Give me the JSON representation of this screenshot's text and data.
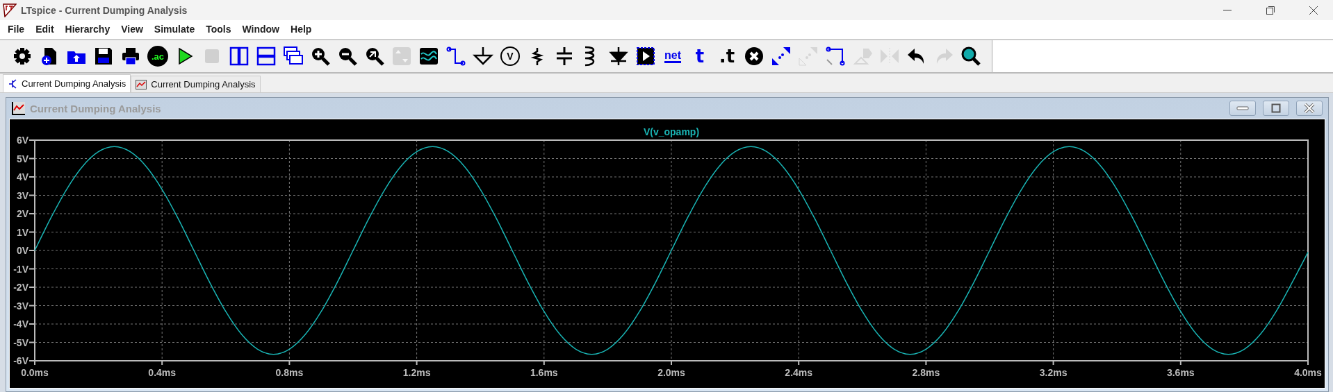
{
  "window": {
    "title": "LTspice - Current Dumping Analysis"
  },
  "menu": [
    "File",
    "Edit",
    "Hierarchy",
    "View",
    "Simulate",
    "Tools",
    "Window",
    "Help"
  ],
  "toolbar": [
    {
      "kind": "icon",
      "disabled": false
    },
    {
      "kind": "icon",
      "disabled": false
    },
    {
      "kind": "icon",
      "disabled": false
    },
    {
      "kind": "icon",
      "disabled": false
    },
    {
      "kind": "icon",
      "disabled": false
    },
    {
      "kind": "text",
      "label": ".ac",
      "disabled": false
    },
    {
      "kind": "icon",
      "disabled": false
    },
    {
      "kind": "icon",
      "disabled": true
    },
    {
      "kind": "icon",
      "disabled": false
    },
    {
      "kind": "icon",
      "disabled": false
    },
    {
      "kind": "icon",
      "disabled": false
    },
    {
      "kind": "icon",
      "disabled": false
    },
    {
      "kind": "icon",
      "disabled": false
    },
    {
      "kind": "icon",
      "disabled": false
    },
    {
      "kind": "icon",
      "disabled": true
    },
    {
      "kind": "icon",
      "disabled": false
    },
    {
      "kind": "icon",
      "disabled": false
    },
    {
      "kind": "icon",
      "disabled": false
    },
    {
      "kind": "text",
      "label": "V",
      "disabled": false
    },
    {
      "kind": "icon",
      "disabled": false
    },
    {
      "kind": "icon",
      "disabled": false
    },
    {
      "kind": "icon",
      "disabled": false
    },
    {
      "kind": "icon",
      "disabled": false
    },
    {
      "kind": "icon",
      "disabled": false
    },
    {
      "kind": "text",
      "label": "net",
      "disabled": false
    },
    {
      "kind": "text",
      "label": "t",
      "disabled": false
    },
    {
      "kind": "text",
      "label": ".t",
      "disabled": false
    },
    {
      "kind": "icon",
      "disabled": false
    },
    {
      "kind": "icon",
      "disabled": false
    },
    {
      "kind": "icon",
      "disabled": true
    },
    {
      "kind": "icon",
      "disabled": false
    },
    {
      "kind": "icon",
      "disabled": true
    },
    {
      "kind": "icon",
      "disabled": true
    },
    {
      "kind": "icon",
      "disabled": false
    },
    {
      "kind": "icon",
      "disabled": true
    },
    {
      "kind": "icon",
      "disabled": false
    }
  ],
  "tabs": [
    {
      "label": "Current Dumping Analysis",
      "kind": "schematic",
      "selected": true
    },
    {
      "label": "Current Dumping Analysis",
      "kind": "waveform",
      "selected": false
    }
  ],
  "plot_window": {
    "title": "Current Dumping Analysis",
    "chart_data": {
      "type": "line",
      "grid": true,
      "x": [
        0,
        0.05,
        0.1,
        0.15,
        0.2,
        0.25,
        0.3,
        0.35,
        0.4,
        0.45,
        0.5,
        0.55,
        0.6,
        0.65,
        0.7,
        0.75,
        0.8,
        0.85,
        0.9,
        0.95,
        1,
        1.05,
        1.1,
        1.15,
        1.2,
        1.25,
        1.3,
        1.35,
        1.4,
        1.45,
        1.5,
        1.55,
        1.6,
        1.65,
        1.7,
        1.75,
        1.8,
        1.85,
        1.9,
        1.95,
        2,
        2.05,
        2.1,
        2.15,
        2.2,
        2.25,
        2.3,
        2.35,
        2.4,
        2.45,
        2.5,
        2.55,
        2.6,
        2.65,
        2.7,
        2.75,
        2.8,
        2.85,
        2.9,
        2.95,
        3,
        3.05,
        3.1,
        3.15,
        3.2,
        3.25,
        3.3,
        3.35,
        3.4,
        3.45,
        3.5,
        3.55,
        3.6,
        3.65,
        3.7,
        3.75,
        3.8,
        3.85,
        3.9,
        3.95,
        4
      ],
      "series": [
        {
          "name": "V(v_opamp)",
          "color": "#19b4b4",
          "values": [
            0,
            1.75,
            3.32,
            4.57,
            5.37,
            5.65,
            5.37,
            4.57,
            3.32,
            1.75,
            0,
            -1.75,
            -3.32,
            -4.57,
            -5.37,
            -5.65,
            -5.37,
            -4.57,
            -3.32,
            -1.75,
            0,
            1.75,
            3.32,
            4.57,
            5.37,
            5.65,
            5.37,
            4.57,
            3.32,
            1.75,
            0,
            -1.75,
            -3.32,
            -4.57,
            -5.37,
            -5.65,
            -5.37,
            -4.57,
            -3.32,
            -1.75,
            0,
            1.75,
            3.32,
            4.57,
            5.37,
            5.65,
            5.37,
            4.57,
            3.32,
            1.75,
            0,
            -1.75,
            -3.32,
            -4.57,
            -5.37,
            -5.65,
            -5.37,
            -4.57,
            -3.32,
            -1.75,
            0,
            1.75,
            3.32,
            4.57,
            5.37,
            5.65,
            5.37,
            4.57,
            3.32,
            1.75,
            0,
            -1.75,
            -3.32,
            -4.57,
            -5.37,
            -5.65,
            -5.37,
            -4.57,
            -3.32,
            -1.75,
            -0.1
          ]
        }
      ],
      "xlim": [
        0,
        4
      ],
      "ylim": [
        -6,
        6
      ],
      "xticks": [
        {
          "value": 0,
          "label": "0.0ms"
        },
        {
          "value": 0.4,
          "label": "0.4ms"
        },
        {
          "value": 0.8,
          "label": "0.8ms"
        },
        {
          "value": 1.2,
          "label": "1.2ms"
        },
        {
          "value": 1.6,
          "label": "1.6ms"
        },
        {
          "value": 2,
          "label": "2.0ms"
        },
        {
          "value": 2.4,
          "label": "2.4ms"
        },
        {
          "value": 2.8,
          "label": "2.8ms"
        },
        {
          "value": 3.2,
          "label": "3.2ms"
        },
        {
          "value": 3.6,
          "label": "3.6ms"
        },
        {
          "value": 4,
          "label": "4.0ms"
        }
      ],
      "yticks": [
        {
          "value": 6,
          "label": "6V"
        },
        {
          "value": 5,
          "label": "5V"
        },
        {
          "value": 4,
          "label": "4V"
        },
        {
          "value": 3,
          "label": "3V"
        },
        {
          "value": 2,
          "label": "2V"
        },
        {
          "value": 1,
          "label": "1V"
        },
        {
          "value": 0,
          "label": "0V"
        },
        {
          "value": -1,
          "label": "-1V"
        },
        {
          "value": -2,
          "label": "-2V"
        },
        {
          "value": -3,
          "label": "-3V"
        },
        {
          "value": -4,
          "label": "-4V"
        },
        {
          "value": -5,
          "label": "-5V"
        },
        {
          "value": -6,
          "label": "-6V"
        }
      ]
    }
  }
}
